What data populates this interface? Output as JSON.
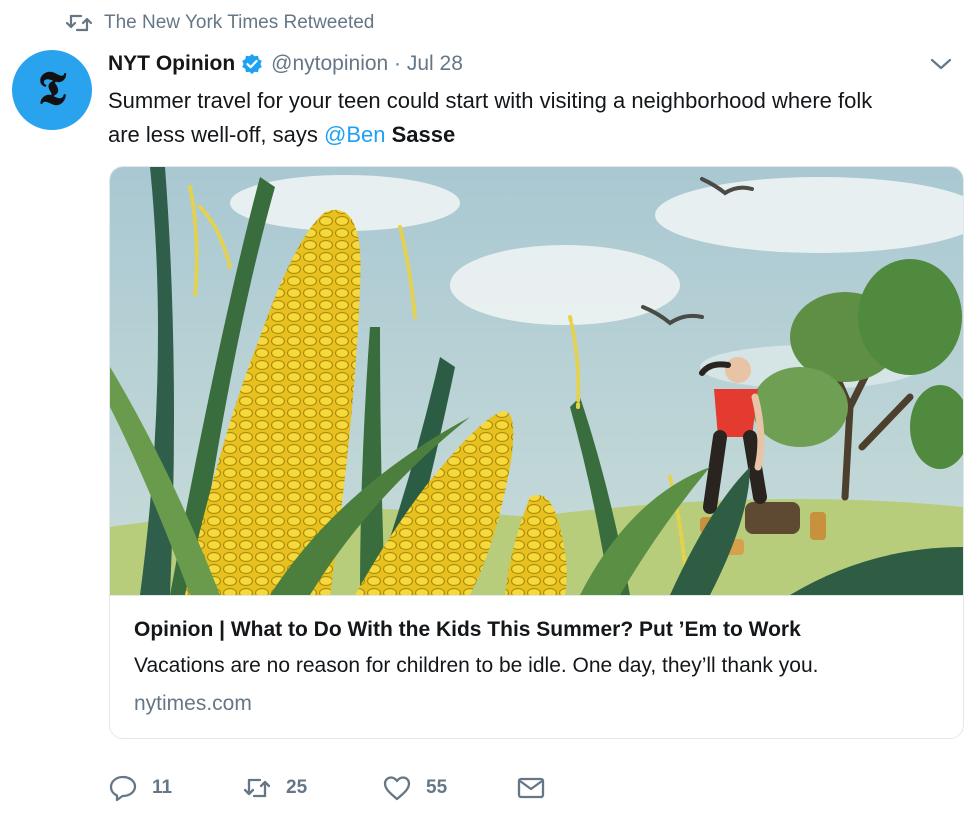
{
  "retweet_context": {
    "text": "The New York Times Retweeted"
  },
  "tweet": {
    "avatar_letter": "𝕿",
    "author_name": "NYT Opinion",
    "handle_date": "@nytopinion · Jul 28",
    "text_line1": "Summer travel for your teen could start with visiting a neighborhood where folk",
    "text_line2_prefix": "are less well-off, says ",
    "mention": "@Ben",
    "bold_word": "Sasse"
  },
  "card": {
    "title": "Opinion | What to Do With the Kids This Summer? Put ’Em to Work",
    "description": "Vacations are no reason for children to be idle. One day, they’ll thank you.",
    "domain": "nytimes.com"
  },
  "actions": {
    "reply_count": "11",
    "retweet_count": "25",
    "like_count": "55"
  },
  "colors": {
    "accent": "#1da1f2",
    "muted": "#657786",
    "avatar_bg": "#2aa3ef"
  }
}
